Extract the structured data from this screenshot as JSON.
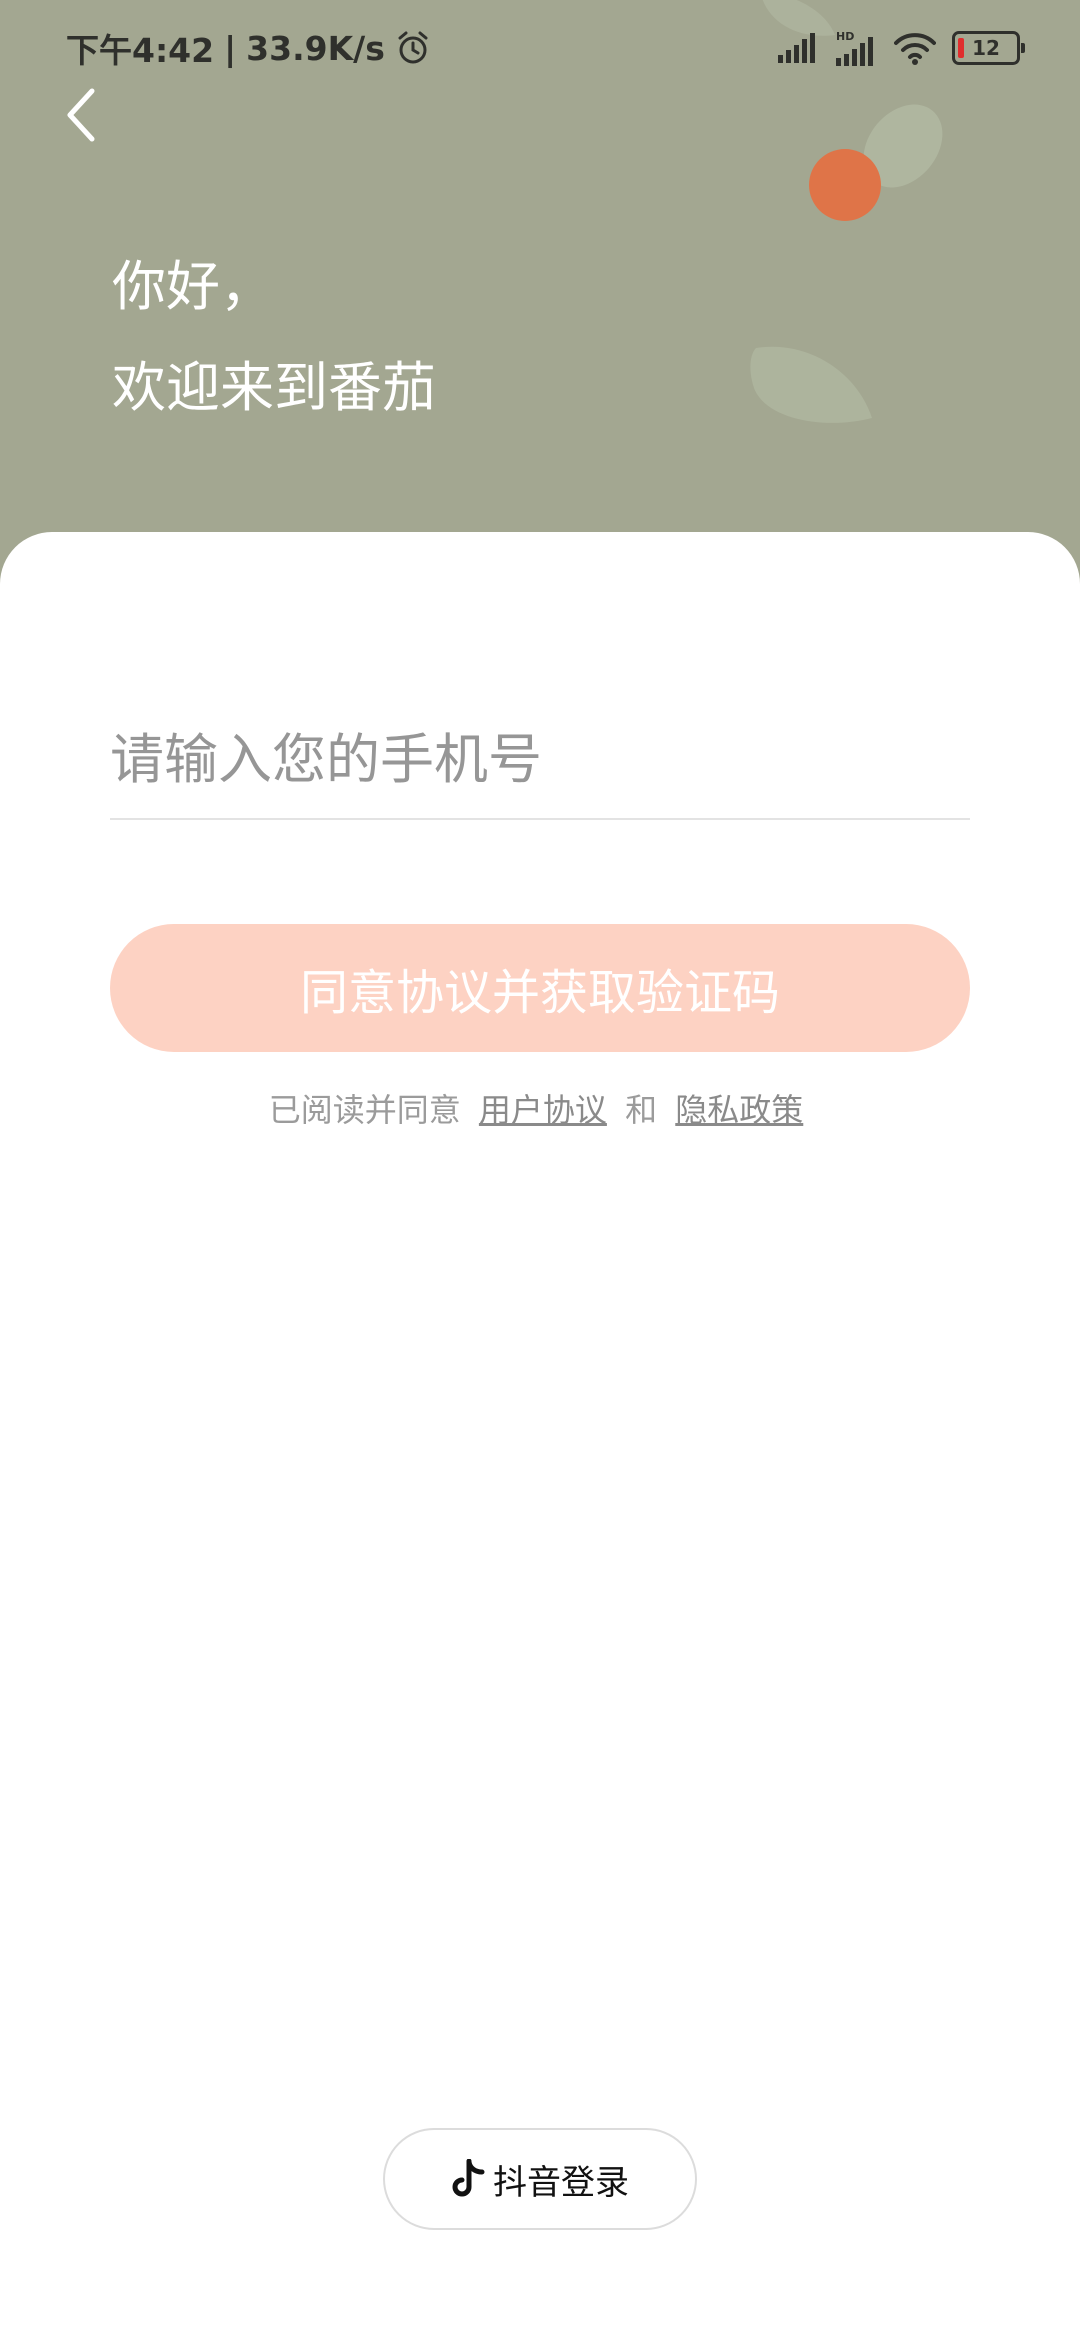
{
  "status_bar": {
    "time": "下午4:42",
    "separator": "|",
    "net_speed": "33.9K/s",
    "battery_level": "12",
    "icons": [
      "alarm-icon",
      "signal-icon",
      "hd-signal-icon",
      "wifi-icon",
      "battery-icon"
    ]
  },
  "header": {
    "back_icon": "chevron-left-icon",
    "greeting_line1": "你好，",
    "greeting_line2": "欢迎来到番茄",
    "background_color": "#a3a791",
    "accent_color": "#df7448"
  },
  "login": {
    "phone_placeholder": "请输入您的手机号",
    "phone_value": "",
    "submit_label": "同意协议并获取验证码",
    "button_color": "#fdd2c3",
    "agreement_prefix": "已阅读并同意",
    "user_agreement_link": "用户协议",
    "agreement_and": "和",
    "privacy_policy_link": "隐私政策"
  },
  "footer": {
    "douyin_login_label": "抖音登录",
    "douyin_icon": "tiktok-icon"
  }
}
